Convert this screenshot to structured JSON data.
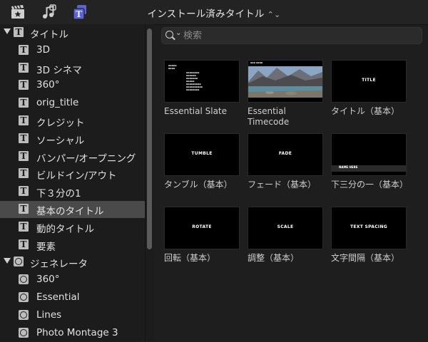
{
  "toolbar": {
    "title": "インストール済みタイトル",
    "icons": [
      "clapper-star-icon",
      "music-notes-icon",
      "titles-icon"
    ],
    "accent_color": "#5b63d6"
  },
  "search": {
    "placeholder": "検索"
  },
  "sidebar": {
    "sections": [
      {
        "label": "タイトル",
        "icon": "title-t-icon",
        "expanded": true,
        "items": [
          "3D",
          "3D シネマ",
          "360°",
          "orig_title",
          "クレジット",
          "ソーシャル",
          "バンパー/オープニング",
          "ビルドイン/アウト",
          "下３分の1",
          "基本のタイトル",
          "動的タイトル",
          "要素"
        ]
      },
      {
        "label": "ジェネレータ",
        "icon": "generator-icon",
        "expanded": true,
        "items": [
          "360°",
          "Essential",
          "Lines",
          "Photo Montage 3"
        ]
      }
    ],
    "selected": "基本のタイトル"
  },
  "browser": {
    "items": [
      {
        "caption": "Essential Slate",
        "thumb_text": ""
      },
      {
        "caption": "Essential Timecode",
        "thumb_text": ""
      },
      {
        "caption": "タイトル（基本）",
        "thumb_text": "TITLE"
      },
      {
        "caption": "タンブル（基本）",
        "thumb_text": "TUMBLE"
      },
      {
        "caption": "フェード（基本）",
        "thumb_text": "FADE"
      },
      {
        "caption": "下三分の一（基本）",
        "thumb_text": "NAME HERE"
      },
      {
        "caption": "回転（基本）",
        "thumb_text": "ROTATE"
      },
      {
        "caption": "調整（基本）",
        "thumb_text": "SCALE"
      },
      {
        "caption": "文字間隔（基本）",
        "thumb_text": "TEXT SPACING"
      }
    ]
  }
}
